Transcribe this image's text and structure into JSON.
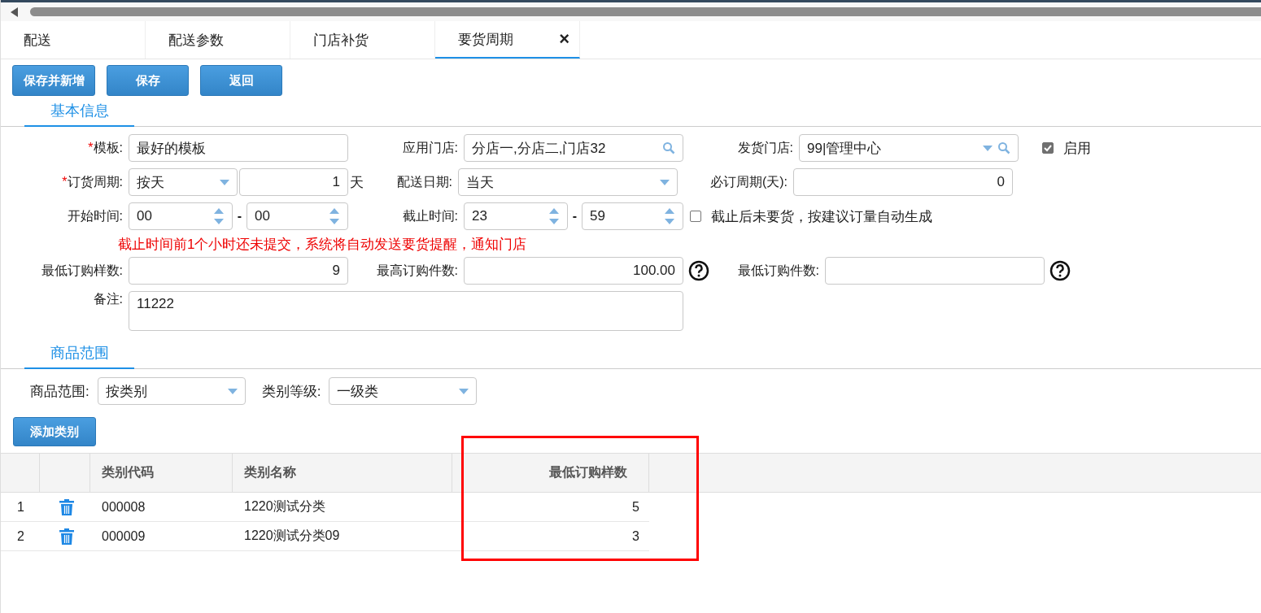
{
  "tabs": [
    {
      "label": "配送",
      "selected": false,
      "closable": false
    },
    {
      "label": "配送参数",
      "selected": false,
      "closable": false
    },
    {
      "label": "门店补货",
      "selected": false,
      "closable": false
    },
    {
      "label": "要货周期",
      "selected": true,
      "closable": true
    }
  ],
  "close_glyph": "×",
  "buttons": [
    "保存并新增",
    "保存",
    "返回"
  ],
  "basic_section": "基本信息",
  "form": {
    "template": {
      "required_mark": "*",
      "label": "模板:",
      "value": "最好的模板"
    },
    "stores": {
      "label": "应用门店:",
      "value": "分店一,分店二,门店32"
    },
    "ship_store": {
      "label": "发货门店:",
      "value": "99|管理中心"
    },
    "enabled": {
      "label": "启用",
      "checked": true
    },
    "cycle": {
      "required_mark": "*",
      "label": "订货周期:",
      "unit_value": "按天",
      "count": "1",
      "unit": "天"
    },
    "delivery_date": {
      "label": "配送日期:",
      "value": "当天"
    },
    "must_cycle": {
      "label": "必订周期(天):",
      "value": "0"
    },
    "start_time": {
      "label": "开始时间:",
      "hour": "00",
      "separator": "-",
      "minute": "00"
    },
    "cutoff_time": {
      "label": "截止时间:",
      "hour": "23",
      "separator": "-",
      "minute": "59"
    },
    "auto_generate": {
      "label": "截止后未要货，按建议订量自动生成",
      "checked": false
    },
    "warning": "截止时间前1个小时还未提交，系统将自动发送要货提醒，通知门店",
    "min_items": {
      "label": "最低订购样数:",
      "value": "9"
    },
    "max_qty": {
      "label": "最高订购件数:",
      "value": "100.00"
    },
    "min_qty": {
      "label": "最低订购件数:"
    },
    "remark": {
      "label": "备注:",
      "value": "11222"
    }
  },
  "range_section": "商品范围",
  "scope": {
    "label": "商品范围:",
    "value": "按类别"
  },
  "level": {
    "label": "类别等级:",
    "value": "一级类"
  },
  "add_button": "添加类别",
  "table": {
    "columns": [
      "类别代码",
      "类别名称",
      "最低订购样数"
    ],
    "rows": [
      {
        "index": "1",
        "code": "000008",
        "name": "1220测试分类",
        "min_items": "5"
      },
      {
        "index": "2",
        "code": "000009",
        "name": "1220测试分类09",
        "min_items": "3"
      }
    ]
  }
}
